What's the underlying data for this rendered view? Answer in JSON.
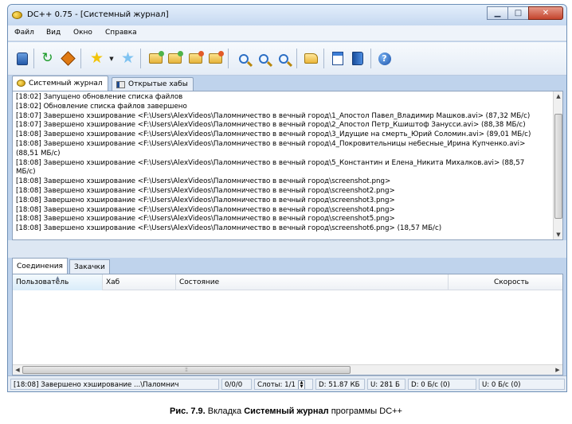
{
  "window": {
    "title": "DC++ 0.75 - [Системный журнал]",
    "buttons": {
      "minimize": "▁",
      "maximize": "□",
      "close": "✕"
    }
  },
  "menu": [
    "Файл",
    "Вид",
    "Окно",
    "Справка"
  ],
  "toolbar": {
    "icons": [
      "users-icon",
      "refresh-icon",
      "reconnect-icon",
      "favorite-hubs-icon",
      "dropdown-arrow-icon",
      "favorite-users-icon",
      "download-queue-icon",
      "finished-downloads-icon",
      "upload-queue-icon",
      "finished-uploads-icon",
      "search-icon",
      "adl-search-icon",
      "search-spy-icon",
      "open-filelist-icon",
      "notepad-icon",
      "system-log-icon",
      "help-icon"
    ]
  },
  "top_tabs": [
    {
      "label": "Системный журнал",
      "active": true
    },
    {
      "label": "Открытые хабы",
      "active": false
    }
  ],
  "log_lines": [
    "[18:02] Запущено обновление списка файлов",
    "[18:02] Обновление списка файлов завершено",
    "[18:07] Завершено хэширование  <F:\\Users\\AlexVideos\\Паломничество в вечный город\\1_Апостол Павел_Владимир Машков.avi> (87,32 МБ/с)",
    "[18:07] Завершено хэширование  <F:\\Users\\AlexVideos\\Паломничество в вечный город\\2_Апостол Петр_Кшиштоф Занусси.avi> (88,38 МБ/с)",
    "[18:08] Завершено хэширование  <F:\\Users\\AlexVideos\\Паломничество в вечный город\\3_Идущие на смерть_Юрий Соломин.avi> (89,01 МБ/с)",
    "[18:08] Завершено хэширование  <F:\\Users\\AlexVideos\\Паломничество в вечный город\\4_Покровительницы небесные_Ирина Купченко.avi>",
    "(88,51 МБ/с)",
    "[18:08] Завершено хэширование  <F:\\Users\\AlexVideos\\Паломничество в вечный город\\5_Константин и Елена_Никита Михалков.avi> (88,57",
    "МБ/с)",
    "[18:08] Завершено хэширование  <F:\\Users\\AlexVideos\\Паломничество в вечный город\\screenshot.png>",
    "[18:08] Завершено хэширование  <F:\\Users\\AlexVideos\\Паломничество в вечный город\\screenshot2.png>",
    "[18:08] Завершено хэширование  <F:\\Users\\AlexVideos\\Паломничество в вечный город\\screenshot3.png>",
    "[18:08] Завершено хэширование  <F:\\Users\\AlexVideos\\Паломничество в вечный город\\screenshot4.png>",
    "[18:08] Завершено хэширование  <F:\\Users\\AlexVideos\\Паломничество в вечный город\\screenshot5.png>",
    "[18:08] Завершено хэширование  <F:\\Users\\AlexVideos\\Паломничество в вечный город\\screenshot6.png> (18,57 МБ/с)"
  ],
  "bottom_tabs": [
    {
      "label": "Соединения",
      "active": true
    },
    {
      "label": "Закачки",
      "active": false
    }
  ],
  "table": {
    "columns": [
      "Пользователь",
      "Хаб",
      "Состояние",
      "Скорость"
    ],
    "rows": []
  },
  "status": {
    "message": "[18:08] Завершено хэширование ...\\Паломнич",
    "hubs": "0/0/0",
    "slots": "Слоты: 1/1",
    "download": "D: 51.87 КБ",
    "upload": "U: 281 Б",
    "download_speed": "D: 0 Б/с (0)",
    "upload_speed": "U: 0 Б/с (0)"
  },
  "caption": {
    "prefix": "Рис. 7.9.",
    "text1": "Вкладка",
    "bold": "Системный журнал",
    "text2": "программы DC++"
  }
}
